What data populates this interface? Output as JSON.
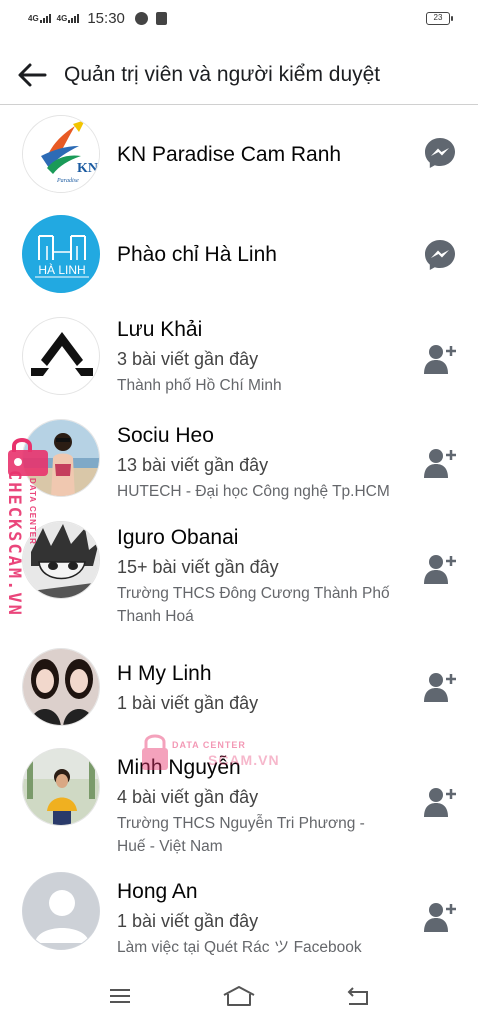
{
  "status_bar": {
    "network_1": "4G",
    "network_2": "4G",
    "time": "15:30",
    "battery": "23"
  },
  "header": {
    "title": "Quản trị viên và người kiểm duyệt"
  },
  "members": [
    {
      "name": "KN Paradise Cam Ranh",
      "posts": "",
      "detail": "",
      "action": "messenger-icon"
    },
    {
      "name": "Phào chỉ Hà Linh",
      "posts": "",
      "detail": "",
      "action": "messenger-icon"
    },
    {
      "name": "Lưu Khải",
      "posts": "3 bài viết gần đây",
      "detail": "Thành phố Hồ Chí Minh",
      "action": "add-friend-icon"
    },
    {
      "name": "Sociu Heo",
      "posts": "13 bài viết gần đây",
      "detail": "HUTECH - Đại học Công nghệ Tp.HCM",
      "action": "add-friend-icon"
    },
    {
      "name": "Iguro Obanai",
      "posts": "15+ bài viết gần đây",
      "detail": "Trường THCS Đông Cương Thành Phố Thanh Hoá",
      "action": "add-friend-icon"
    },
    {
      "name": "H My Linh",
      "posts": "1 bài viết gần đây",
      "detail": "",
      "action": "add-friend-icon"
    },
    {
      "name": "Minh Nguyễn",
      "posts": "4 bài viết gần đây",
      "detail": "Trường THCS Nguyễn Tri Phương - Huế - Việt Nam",
      "action": "add-friend-icon"
    },
    {
      "name": "Hong An",
      "posts": "1 bài viết gần đây",
      "detail": "Làm việc tại Quét Rác ツ Facebook",
      "action": "add-friend-icon"
    }
  ],
  "avatars": {
    "kn_logo_text": "KN",
    "kn_logo_sub": "Paradise",
    "ha_linh_logo_text": "HÀ LINH"
  },
  "watermark": {
    "side_text": "CHECKSCAM.VN",
    "side_small": "DATA CENTER",
    "center_small": "DATA CENTER",
    "center_text": "SCAM.VN"
  },
  "colors": {
    "accent_icon": "#606770",
    "watermark": "#e8336d"
  }
}
